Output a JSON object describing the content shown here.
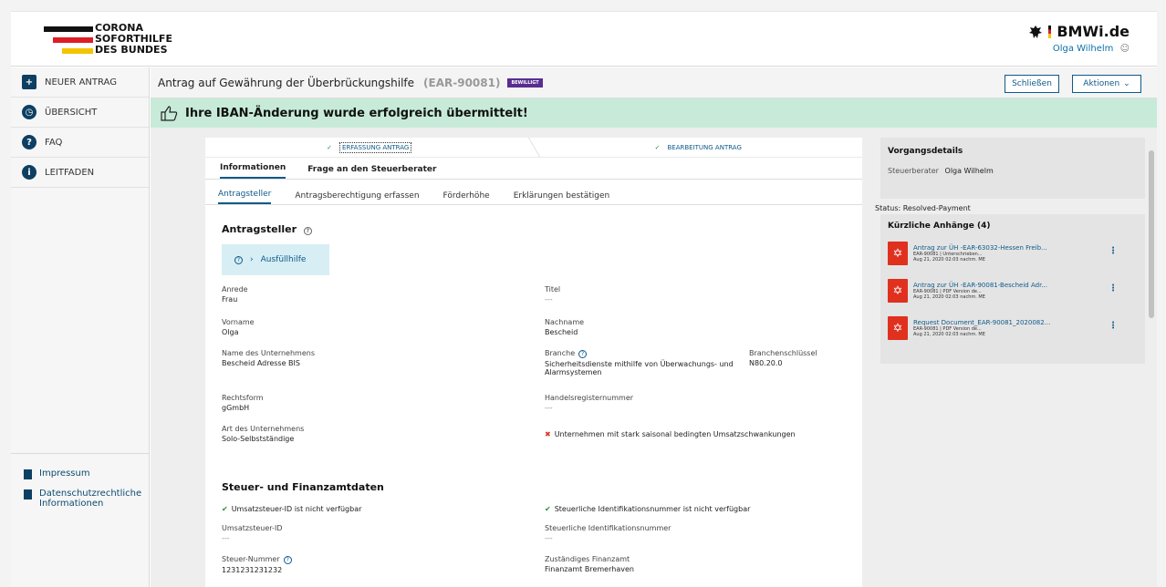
{
  "header": {
    "logo_lines": [
      "CORONA",
      "SOFORTHILFE",
      "DES BUNDES"
    ],
    "brand": "BMWi.de",
    "user": "Olga Wilhelm"
  },
  "sidebar": {
    "items": [
      {
        "label": "NEUER ANTRAG",
        "icon": "plus-icon"
      },
      {
        "label": "ÜBERSICHT",
        "icon": "clock-icon"
      },
      {
        "label": "FAQ",
        "icon": "question-icon"
      },
      {
        "label": "LEITFADEN",
        "icon": "info-icon"
      }
    ],
    "footer": [
      "Impressum",
      "Datenschutzrechtliche Informationen"
    ]
  },
  "titlebar": {
    "title": "Antrag auf Gewährung der Überbrückungshilfe",
    "id": "(EAR-90081)",
    "badge": "BEWILLIGT",
    "close": "Schließen",
    "actions": "Aktionen"
  },
  "banner": "Ihre IBAN-Änderung wurde erfolgreich übermittelt!",
  "steps": [
    "ERFASSUNG ANTRAG",
    "BEARBEITUNG ANTRAG"
  ],
  "tabs1": [
    "Informationen",
    "Frage an den Steuerberater"
  ],
  "tabs2": [
    "Antragsteller",
    "Antragsberechtigung erfassen",
    "Förderhöhe",
    "Erklärungen bestätigen"
  ],
  "section1": {
    "heading": "Antragsteller",
    "help": "Ausfüllhilfe",
    "fields": {
      "anrede_l": "Anrede",
      "anrede_v": "Frau",
      "titel_l": "Titel",
      "titel_v": "---",
      "vorname_l": "Vorname",
      "vorname_v": "Olga",
      "nachname_l": "Nachname",
      "nachname_v": "Bescheid",
      "unternehmen_l": "Name des Unternehmens",
      "unternehmen_v": "Bescheid Adresse BIS",
      "branche_l": "Branche",
      "branche_v1": "Sicherheitsdienste mithilfe von Überwachungs- und",
      "branche_v2": "Alarmsystemen",
      "schluessel_l": "Branchenschlüssel",
      "schluessel_v": "N80.20.0",
      "rechtsform_l": "Rechtsform",
      "rechtsform_v": "gGmbH",
      "register_l": "Handelsregisternummer",
      "register_v": "---",
      "art_l": "Art des Unternehmens",
      "art_v": "Solo-Selbstständige",
      "saison": "Unternehmen mit stark saisonal bedingten Umsatzschwankungen"
    }
  },
  "section2": {
    "heading": "Steuer- und Finanzamtdaten",
    "fields": {
      "ust_check": "Umsatzsteuer-ID ist nicht verfügbar",
      "stid_check": "Steuerliche Identifikationsnummer ist nicht verfügbar",
      "ust_l": "Umsatzsteuer-ID",
      "ust_v": "---",
      "stid_l": "Steuerliche Identifikationsnummer",
      "stid_v": "---",
      "stnr_l": "Steuer-Nummer",
      "stnr_v": "1231231231232",
      "fa_l": "Zuständiges Finanzamt",
      "fa_v": "Finanzamt Bremerhaven"
    }
  },
  "details": {
    "heading": "Vorgangsdetails",
    "berater_l": "Steuerberater",
    "berater_v": "Olga Wilhelm",
    "status": "Status:  Resolved-Payment"
  },
  "attachments": {
    "heading": "Kürzliche Anhänge (4)",
    "items": [
      {
        "title": "Antrag zur ÜH -EAR-63032-Hessen Freib...",
        "sub": "EAR-90081 | Unterschrieben...",
        "date": "Aug 21, 2020 02:03 nachm. ME"
      },
      {
        "title": "Antrag zur ÜH -EAR-90081-Bescheid Adr...",
        "sub": "EAR-90081 | PDF Version de...",
        "date": "Aug 21, 2020 02:03 nachm. ME"
      },
      {
        "title": "Request Document_EAR-90081_2020082...",
        "sub": "EAR-90081 | PDF Version de...",
        "date": "Aug 21, 2020 02:03 nachm. ME"
      }
    ]
  }
}
